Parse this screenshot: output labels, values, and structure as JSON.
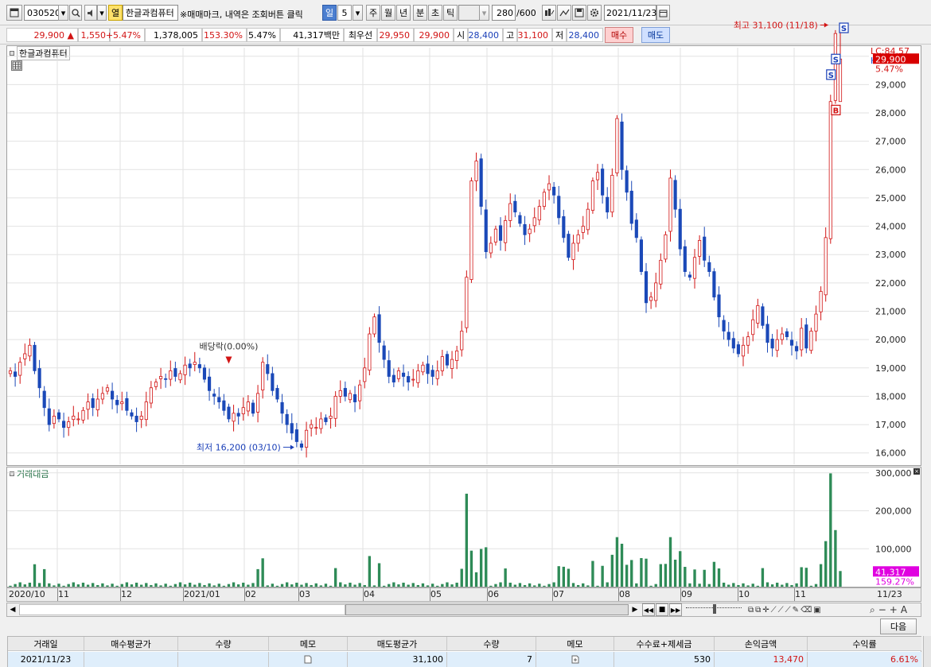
{
  "toolbar": {
    "code": "030520",
    "stock_badge": "열",
    "stock_name": "한글과컴퓨터",
    "notice": "※매매마크, 내역은 조회버튼 클릭",
    "periods": [
      "일",
      "5",
      "주",
      "월",
      "년",
      "분",
      "초",
      "틱"
    ],
    "selected_period": "일",
    "count_value": "280",
    "count_max": "/600",
    "date": "2021/11/23"
  },
  "quote": {
    "price": "29,900",
    "arrow": "▲",
    "change": "1,550",
    "change_pct": "+5.47%",
    "volume": "1,378,005",
    "volume_ratio": "153.30%",
    "turnover_pct": "5.47%",
    "amount": "41,317백만",
    "best_label": "최우선",
    "best_ask": "29,950",
    "best_bid": "29,900",
    "open_label": "시",
    "open": "28,400",
    "high_label": "고",
    "high": "31,100",
    "low_label": "저",
    "low": "28,400",
    "buy_label": "매수",
    "sell_label": "매도"
  },
  "price_pane": {
    "title": "한글과컴퓨터",
    "lc": "LC:84.57",
    "hc": "HC:-3.86",
    "current_tag": "29,900",
    "current_pct": "5.47%",
    "y_ticks": [
      "29,000",
      "28,000",
      "27,000",
      "26,000",
      "25,000",
      "24,000",
      "23,000",
      "22,000",
      "21,000",
      "20,000",
      "19,000",
      "18,000",
      "17,000",
      "16,000"
    ],
    "y_hidden_tick": "30,000",
    "high_note": "최고 31,100 (11/18)",
    "low_note": "최저 16,200 (03/10)",
    "dividend_note": "배당락(0.00%)",
    "signals": [
      "S",
      "S",
      "S",
      "B"
    ]
  },
  "volume_pane": {
    "title": "거래대금",
    "y_ticks": [
      "300,000",
      "200,000",
      "100,000"
    ],
    "current_tag": "41,317",
    "current_pct": "159.27%"
  },
  "x_axis": {
    "labels": [
      "2020/10",
      "11",
      "12",
      "2021/01",
      "02",
      "03",
      "04",
      "05",
      "06",
      "07",
      "08",
      "09",
      "10",
      "11",
      "11/23"
    ]
  },
  "colors": {
    "up": "#d21414",
    "down": "#1b49b8",
    "volume": "#2e8b57",
    "current_tag_bg": "#d80000",
    "volume_tag_bg": "#e000e0"
  },
  "table": {
    "next_label": "다음",
    "headers": [
      "거래일",
      "매수평균가",
      "수량",
      "메모",
      "매도평균가",
      "수량",
      "메모",
      "수수료+제세금",
      "손익금액",
      "수익률"
    ],
    "row": {
      "date": "2021/11/23",
      "buy_avg": "",
      "buy_qty": "",
      "sell_avg": "31,100",
      "sell_qty": "7",
      "fee": "530",
      "pnl": "13,470",
      "ret": "6.61%"
    }
  },
  "chart_data": {
    "type": "candlestick",
    "price_axis_range": [
      15600,
      30300
    ],
    "volume_axis_range": [
      0,
      310000
    ],
    "period_start": "2020/10",
    "period_end": "2021/11/23",
    "bars": 280,
    "annotated": {
      "high": {
        "value": 31100,
        "date": "11/18"
      },
      "low": {
        "value": 16200,
        "date": "03/10"
      },
      "last": {
        "close": 29900,
        "open": 28400,
        "high": 31100,
        "low": 28400
      }
    },
    "closes": [
      18900,
      18700,
      19200,
      19500,
      19800,
      18900,
      18300,
      17600,
      17000,
      17300,
      17200,
      16900,
      17100,
      17300,
      17200,
      17500,
      17800,
      17600,
      17900,
      18100,
      18300,
      17900,
      17700,
      17800,
      17500,
      17300,
      17100,
      17300,
      17800,
      18300,
      18500,
      18700,
      18600,
      18900,
      18700,
      18800,
      19100,
      19000,
      19200,
      19000,
      18600,
      18200,
      18000,
      17800,
      17500,
      17200,
      17400,
      17300,
      17600,
      17800,
      17400,
      18100,
      19200,
      18800,
      18200,
      17900,
      17400,
      17000,
      16700,
      16400,
      16200,
      16800,
      17000,
      16900,
      17200,
      17100,
      17300,
      18000,
      18200,
      18000,
      18100,
      17800,
      18400,
      19000,
      20200,
      20800,
      19900,
      19300,
      18700,
      18500,
      18900,
      18700,
      18500,
      18600,
      18900,
      19100,
      18800,
      18700,
      18900,
      19400,
      19100,
      19300,
      19600,
      20300,
      22200,
      25600,
      26300,
      24700,
      23100,
      23400,
      23900,
      23500,
      24200,
      24800,
      24500,
      24100,
      23700,
      23900,
      24300,
      24700,
      25200,
      25500,
      25100,
      24300,
      23600,
      22900,
      23400,
      23700,
      24000,
      24600,
      25600,
      25900,
      25100,
      24500,
      25800,
      27800,
      26000,
      25200,
      24100,
      23600,
      22400,
      21300,
      21500,
      22000,
      22800,
      23700,
      25700,
      24600,
      23200,
      22400,
      22200,
      22900,
      23500,
      22800,
      22400,
      21500,
      20800,
      20300,
      20000,
      19700,
      19500,
      19800,
      20100,
      20700,
      21200,
      20500,
      19900,
      19700,
      20000,
      20200,
      20100,
      19800,
      19600,
      20400,
      19700,
      20300,
      20900,
      21700,
      23600,
      28400,
      30800,
      29900
    ]
  }
}
